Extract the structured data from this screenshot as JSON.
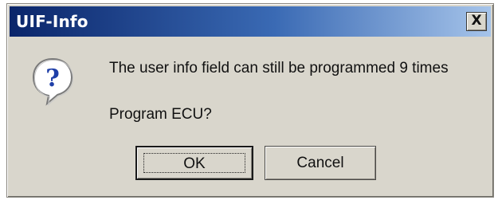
{
  "window": {
    "title": "UIF-Info",
    "close_label": "X"
  },
  "icon": "question-icon",
  "message": "The user info field can still be programmed 9 times",
  "prompt": "Program ECU?",
  "buttons": {
    "ok_label": "OK",
    "cancel_label": "Cancel"
  },
  "colors": {
    "titlebar_start": "#0a256a",
    "titlebar_end": "#a6c4ea",
    "dialog_bg": "#d9d6cc",
    "icon_blue": "#1f3fa8"
  }
}
